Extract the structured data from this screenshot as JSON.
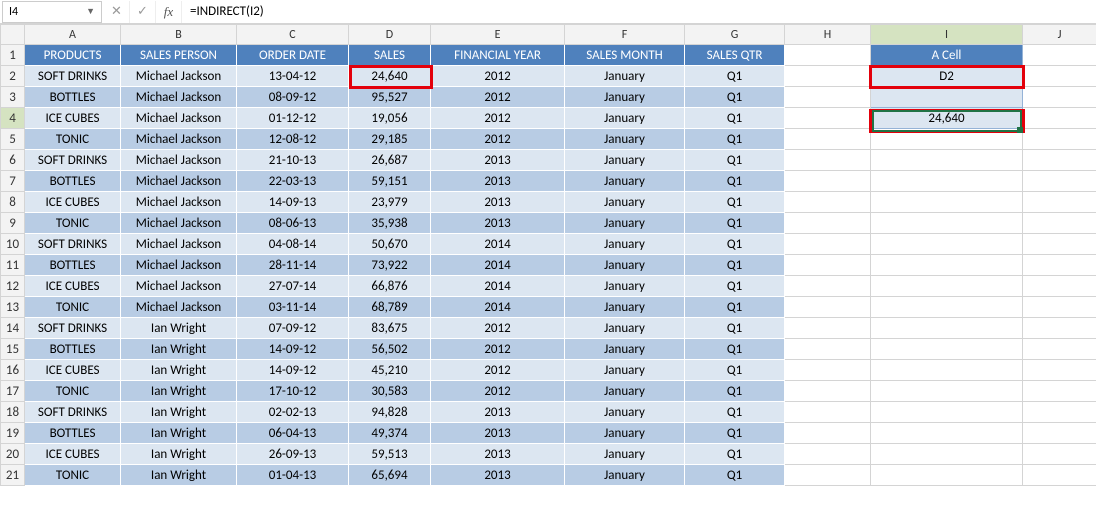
{
  "formula_bar": {
    "cell_ref": "I4",
    "cancel": "✕",
    "confirm": "✓",
    "fx": "fx",
    "formula": "=INDIRECT(I2)"
  },
  "col_letters": [
    "A",
    "B",
    "C",
    "D",
    "E",
    "F",
    "G",
    "H",
    "I",
    "J"
  ],
  "headers": {
    "A": "PRODUCTS",
    "B": "SALES PERSON",
    "C": "ORDER DATE",
    "D": "SALES",
    "E": "FINANCIAL YEAR",
    "F": "SALES MONTH",
    "G": "SALES QTR",
    "I": "A Cell"
  },
  "side": {
    "I2": "D2",
    "I4": "24,640"
  },
  "rows": [
    {
      "n": "2",
      "p": "SOFT DRINKS",
      "sp": "Michael Jackson",
      "d": "13-04-12",
      "s": "24,640",
      "y": "2012",
      "m": "January",
      "q": "Q1"
    },
    {
      "n": "3",
      "p": "BOTTLES",
      "sp": "Michael Jackson",
      "d": "08-09-12",
      "s": "95,527",
      "y": "2012",
      "m": "January",
      "q": "Q1"
    },
    {
      "n": "4",
      "p": "ICE CUBES",
      "sp": "Michael Jackson",
      "d": "01-12-12",
      "s": "19,056",
      "y": "2012",
      "m": "January",
      "q": "Q1"
    },
    {
      "n": "5",
      "p": "TONIC",
      "sp": "Michael Jackson",
      "d": "12-08-12",
      "s": "29,185",
      "y": "2012",
      "m": "January",
      "q": "Q1"
    },
    {
      "n": "6",
      "p": "SOFT DRINKS",
      "sp": "Michael Jackson",
      "d": "21-10-13",
      "s": "26,687",
      "y": "2013",
      "m": "January",
      "q": "Q1"
    },
    {
      "n": "7",
      "p": "BOTTLES",
      "sp": "Michael Jackson",
      "d": "22-03-13",
      "s": "59,151",
      "y": "2013",
      "m": "January",
      "q": "Q1"
    },
    {
      "n": "8",
      "p": "ICE CUBES",
      "sp": "Michael Jackson",
      "d": "14-09-13",
      "s": "23,979",
      "y": "2013",
      "m": "January",
      "q": "Q1"
    },
    {
      "n": "9",
      "p": "TONIC",
      "sp": "Michael Jackson",
      "d": "08-06-13",
      "s": "35,938",
      "y": "2013",
      "m": "January",
      "q": "Q1"
    },
    {
      "n": "10",
      "p": "SOFT DRINKS",
      "sp": "Michael Jackson",
      "d": "04-08-14",
      "s": "50,670",
      "y": "2014",
      "m": "January",
      "q": "Q1"
    },
    {
      "n": "11",
      "p": "BOTTLES",
      "sp": "Michael Jackson",
      "d": "28-11-14",
      "s": "73,922",
      "y": "2014",
      "m": "January",
      "q": "Q1"
    },
    {
      "n": "12",
      "p": "ICE CUBES",
      "sp": "Michael Jackson",
      "d": "27-07-14",
      "s": "66,876",
      "y": "2014",
      "m": "January",
      "q": "Q1"
    },
    {
      "n": "13",
      "p": "TONIC",
      "sp": "Michael Jackson",
      "d": "03-11-14",
      "s": "68,789",
      "y": "2014",
      "m": "January",
      "q": "Q1"
    },
    {
      "n": "14",
      "p": "SOFT DRINKS",
      "sp": "Ian Wright",
      "d": "07-09-12",
      "s": "83,675",
      "y": "2012",
      "m": "January",
      "q": "Q1"
    },
    {
      "n": "15",
      "p": "BOTTLES",
      "sp": "Ian Wright",
      "d": "14-09-12",
      "s": "56,502",
      "y": "2012",
      "m": "January",
      "q": "Q1"
    },
    {
      "n": "16",
      "p": "ICE CUBES",
      "sp": "Ian Wright",
      "d": "14-09-12",
      "s": "45,210",
      "y": "2012",
      "m": "January",
      "q": "Q1"
    },
    {
      "n": "17",
      "p": "TONIC",
      "sp": "Ian Wright",
      "d": "17-10-12",
      "s": "30,583",
      "y": "2012",
      "m": "January",
      "q": "Q1"
    },
    {
      "n": "18",
      "p": "SOFT DRINKS",
      "sp": "Ian Wright",
      "d": "02-02-13",
      "s": "94,828",
      "y": "2013",
      "m": "January",
      "q": "Q1"
    },
    {
      "n": "19",
      "p": "BOTTLES",
      "sp": "Ian Wright",
      "d": "06-04-13",
      "s": "49,374",
      "y": "2013",
      "m": "January",
      "q": "Q1"
    },
    {
      "n": "20",
      "p": "ICE CUBES",
      "sp": "Ian Wright",
      "d": "26-09-13",
      "s": "59,513",
      "y": "2013",
      "m": "January",
      "q": "Q1"
    },
    {
      "n": "21",
      "p": "TONIC",
      "sp": "Ian Wright",
      "d": "01-04-13",
      "s": "65,694",
      "y": "2013",
      "m": "January",
      "q": "Q1"
    }
  ]
}
